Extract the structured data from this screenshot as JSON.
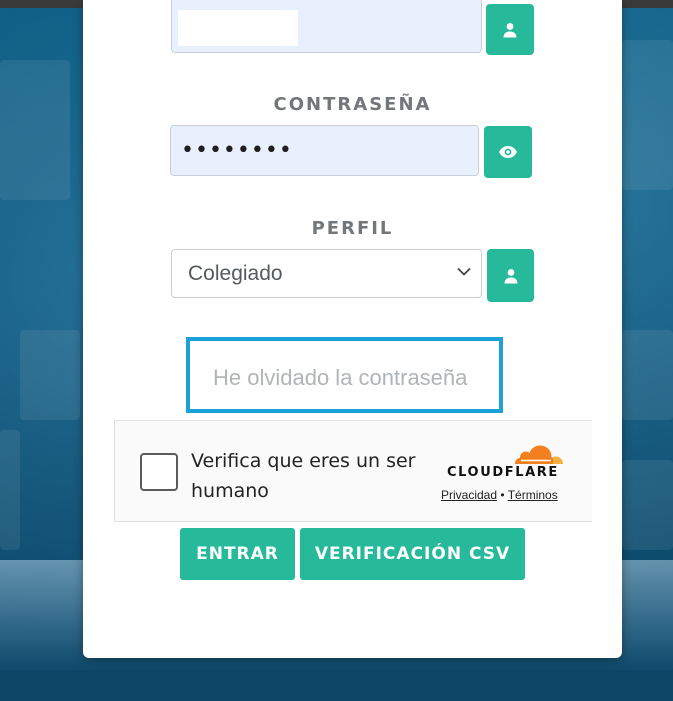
{
  "form": {
    "password_label": "CONTRASEÑA",
    "password_value": "••••••••",
    "profile_label": "PERFIL",
    "profile_selected": "Colegiado",
    "forgot_password": "He olvidado la contraseña"
  },
  "captcha": {
    "prompt": "Verifica que eres un ser humano",
    "brand": "CLOUDFLARE",
    "privacy": "Privacidad",
    "separator": "•",
    "terms": "Términos"
  },
  "actions": {
    "login_label": "ENTRAR",
    "csv_label": "VERIFICACIÓN CSV"
  },
  "icons": {
    "username": "user-icon",
    "password_toggle": "eye-icon",
    "profile": "user-icon",
    "select_chevron": "chevron-down-icon",
    "captcha_logo": "cloudflare-cloud-icon"
  },
  "colors": {
    "accent": "#26b99a",
    "focus_border": "#1ba0d7",
    "autofill_bg": "#e8f0fe",
    "cloudflare_orange": "#f38020"
  }
}
